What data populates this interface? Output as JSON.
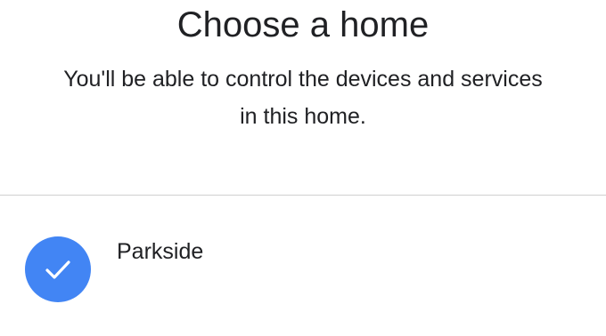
{
  "header": {
    "title": "Choose a home",
    "subtitle": "You'll be able to control the devices and services in this home."
  },
  "homes": [
    {
      "name": "Parkside",
      "selected": true,
      "icon": "checkmark-icon"
    }
  ],
  "colors": {
    "accent": "#4285f4",
    "text": "#202124",
    "divider": "#d0d0d0",
    "background": "#ffffff"
  }
}
